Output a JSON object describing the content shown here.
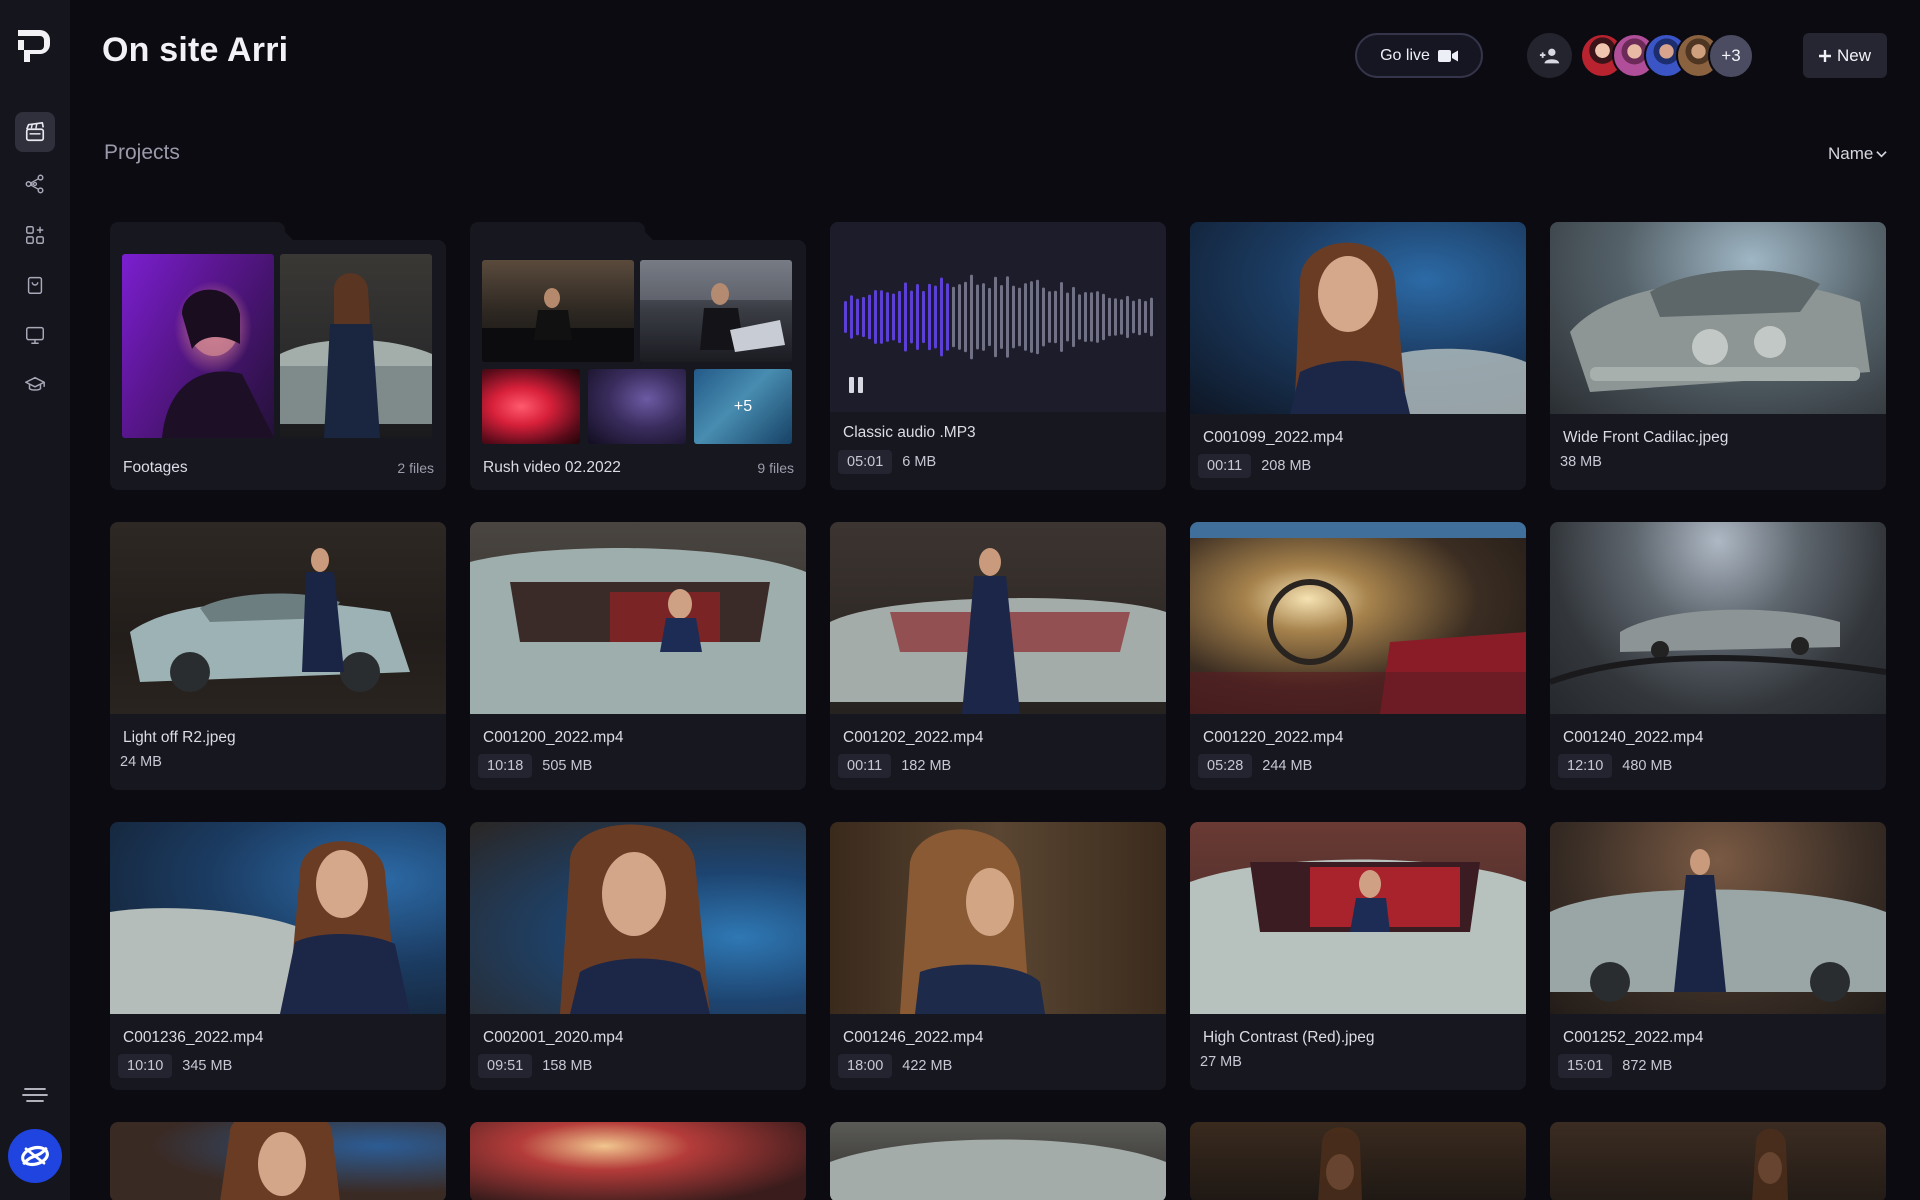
{
  "header": {
    "title": "On site Arri",
    "go_live_label": "Go live",
    "more_collaborators": "+3",
    "new_label": "New"
  },
  "section": {
    "title": "Projects",
    "sort_label": "Name"
  },
  "sidebar": {
    "items": [
      {
        "name": "projects",
        "icon": "clapperboard-icon",
        "active": true
      },
      {
        "name": "share",
        "icon": "share-icon",
        "active": false
      },
      {
        "name": "apps",
        "icon": "apps-add-icon",
        "active": false
      },
      {
        "name": "bag",
        "icon": "bag-icon",
        "active": false
      },
      {
        "name": "display",
        "icon": "monitor-icon",
        "active": false
      },
      {
        "name": "learn",
        "icon": "graduation-cap-icon",
        "active": false
      }
    ]
  },
  "folders": [
    {
      "name": "Footages",
      "count": "2 files"
    },
    {
      "name": "Rush video 02.2022",
      "count": "9 files",
      "overflow": "+5"
    }
  ],
  "audio": {
    "name": "Classic audio .MP3",
    "duration": "05:01",
    "size": "6 MB"
  },
  "files": [
    {
      "name": "C001099_2022.mp4",
      "duration": "00:11",
      "size": "208 MB"
    },
    {
      "name": "Wide Front Cadilac.jpeg",
      "duration": "",
      "size": "38 MB"
    },
    {
      "name": "Light off R2.jpeg",
      "duration": "",
      "size": "24 MB"
    },
    {
      "name": "C001200_2022.mp4",
      "duration": "10:18",
      "size": "505 MB"
    },
    {
      "name": "C001202_2022.mp4",
      "duration": "00:11",
      "size": "182 MB"
    },
    {
      "name": "C001220_2022.mp4",
      "duration": "05:28",
      "size": "244 MB"
    },
    {
      "name": "C001240_2022.mp4",
      "duration": "12:10",
      "size": "480 MB"
    },
    {
      "name": "C001236_2022.mp4",
      "duration": "10:10",
      "size": "345 MB"
    },
    {
      "name": "C002001_2020.mp4",
      "duration": "09:51",
      "size": "158 MB"
    },
    {
      "name": "C001246_2022.mp4",
      "duration": "18:00",
      "size": "422 MB"
    },
    {
      "name": "High Contrast (Red).jpeg",
      "duration": "",
      "size": "27 MB"
    },
    {
      "name": "C001252_2022.mp4",
      "duration": "15:01",
      "size": "872 MB"
    }
  ],
  "colors": {
    "background": "#0b0b11",
    "sidebar": "#15151d",
    "card": "#17171f",
    "brand": "#1f44e0",
    "waveform": "#5b3fd6"
  }
}
